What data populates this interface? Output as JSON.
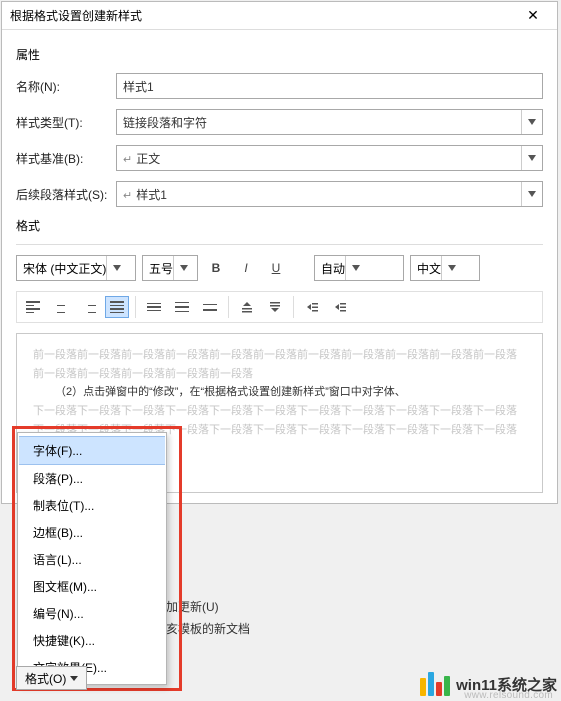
{
  "title": "根据格式设置创建新样式",
  "attrs_label": "属性",
  "fields": {
    "name_label": "名称(N):",
    "name_value": "样式1",
    "type_label": "样式类型(T):",
    "type_value": "链接段落和字符",
    "base_label": "样式基准(B):",
    "base_value": "正文",
    "follow_label": "后续段落样式(S):",
    "follow_value": "样式1"
  },
  "format_label": "格式",
  "toolbar": {
    "font": "宋体 (中文正文)",
    "size": "五号",
    "bold": "B",
    "italic": "I",
    "underline": "U",
    "color": "自动",
    "lang": "中文"
  },
  "preview": {
    "before": "前一段落前一段落前一段落前一段落前一段落前一段落前一段落前一段落前一段落前一段落前一段落前一段落前一段落前一段落前一段落前一段落",
    "main": "（2）点击弹窗中的“修改”，在“根据格式设置创建新样式”窗口中对字体、",
    "after": "下一段落下一段落下一段落下一段落下一段落下一段落下一段落下一段落下一段落下一段落下一段落下一段落下一段落下一段落下一段落下一段落下一段落下一段落下一段落下一段落下一段落下一段落下一段落下一段"
  },
  "format_menu": {
    "items": [
      "字体(F)...",
      "段落(P)...",
      "制表位(T)...",
      "边框(B)...",
      "语言(L)...",
      "图文框(M)...",
      "编号(N)...",
      "快捷键(K)...",
      "文字效果(E)..."
    ],
    "button": "格式(O)"
  },
  "behind": {
    "auto_update": "加更新(U)",
    "templates": "亥模板的新文档"
  },
  "watermark": {
    "brand": "win11系统之家",
    "url": "www.relsound.com"
  }
}
